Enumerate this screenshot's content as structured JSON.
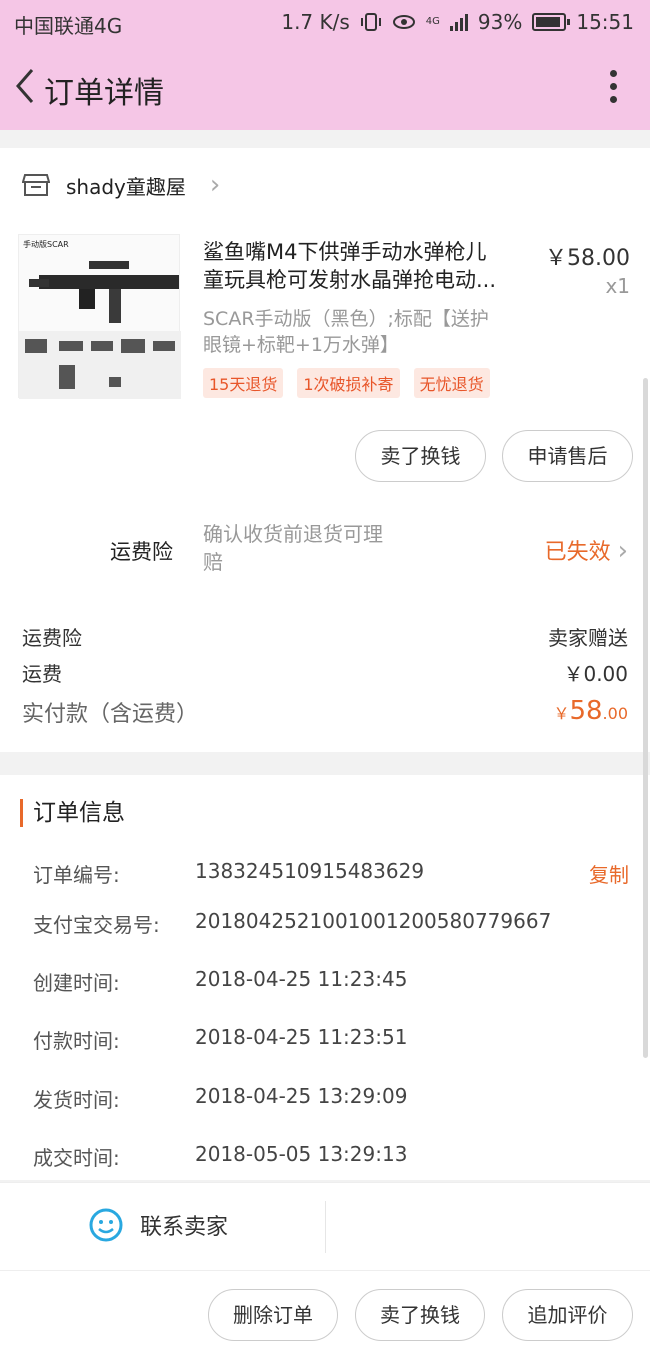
{
  "status_bar": {
    "carrier": "中国联通4G",
    "speed": "1.7 K/s",
    "network": "4G",
    "battery": "93%",
    "time": "15:51"
  },
  "header": {
    "title": "订单详情"
  },
  "shop": {
    "name": "shady童趣屋"
  },
  "product": {
    "title_line1": "鲨鱼嘴M4下供弹手动水弹枪儿",
    "title_line2": "童玩具枪可发射水晶弹抢电动...",
    "price": "￥58.00",
    "qty": "x1",
    "spec_line1": "SCAR手动版（黑色）;标配【送护",
    "spec_line2": "眼镜+标靶+1万水弹】",
    "thumb_label": "手动版SCAR",
    "tags": [
      "15天退货",
      "1次破损补寄",
      "无忧退货"
    ]
  },
  "item_actions": {
    "sell_label": "卖了换钱",
    "after_sale_label": "申请售后"
  },
  "insurance": {
    "label": "运费险",
    "desc_line1": "确认收货前退货可理",
    "desc_line2": "赔",
    "status": "已失效"
  },
  "fees": {
    "ins_label": "运费险",
    "ins_value": "卖家赠送",
    "ship_label": "运费",
    "ship_value": "￥0.00",
    "paid_label": "实付款（含运费）",
    "paid_symbol": "￥",
    "paid_int": "58",
    "paid_dec": ".00"
  },
  "order_info": {
    "title": "订单信息",
    "copy_label": "复制",
    "rows": [
      {
        "k": "订单编号:",
        "v": "138324510915483629"
      },
      {
        "k": "支付宝交易号:",
        "v": "2018042521001001200580779667"
      },
      {
        "k": "创建时间:",
        "v": "2018-04-25 11:23:45"
      },
      {
        "k": "付款时间:",
        "v": "2018-04-25 11:23:51"
      },
      {
        "k": "发货时间:",
        "v": "2018-04-25 13:29:09"
      },
      {
        "k": "成交时间:",
        "v": "2018-05-05 13:29:13"
      }
    ]
  },
  "contact": {
    "label": "联系卖家"
  },
  "bottom_bar": {
    "delete_label": "删除订单",
    "sell_label": "卖了换钱",
    "review_label": "追加评价"
  },
  "colors": {
    "accent": "#e8692a",
    "header_bg": "#f5c6e6"
  }
}
